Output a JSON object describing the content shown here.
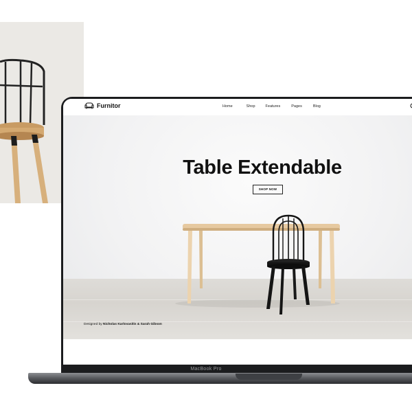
{
  "brand": {
    "name": "Furnitor"
  },
  "nav": {
    "items": [
      {
        "label": "Home"
      },
      {
        "label": "Shop"
      },
      {
        "label": "Features"
      },
      {
        "label": "Pages"
      },
      {
        "label": "Blog"
      }
    ]
  },
  "hero": {
    "title": "Table Extendable",
    "cta_label": "SHOP NOW",
    "credit_prefix": "Designed by",
    "credit_names": "Nicholas Karlovasitis & Sarah Gibson"
  },
  "laptop": {
    "bezel_label": "MacBook Pro"
  },
  "icons": {
    "logo": "armchair-icon",
    "search": "search-icon"
  },
  "colors": {
    "text": "#111111",
    "laptop_frame": "#1b1c1e",
    "table_wood": "#e3c79f",
    "chair_black": "#151515"
  }
}
